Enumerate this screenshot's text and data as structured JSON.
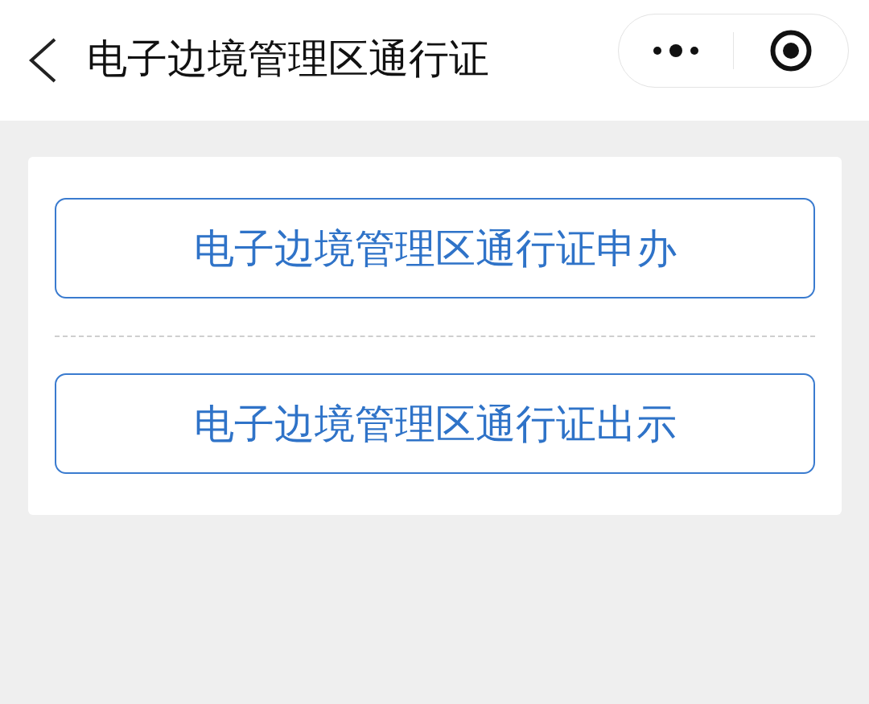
{
  "header": {
    "title": "电子边境管理区通行证"
  },
  "buttons": [
    {
      "label": "电子边境管理区通行证申办"
    },
    {
      "label": "电子边境管理区通行证出示"
    }
  ]
}
